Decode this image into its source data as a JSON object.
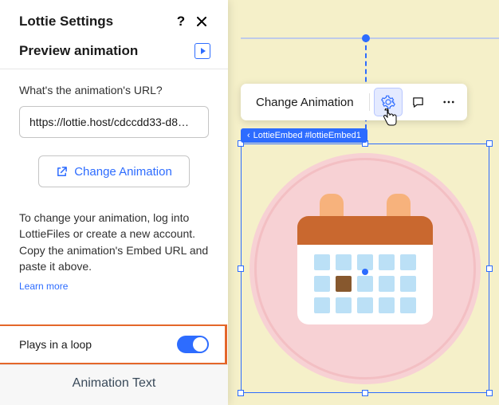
{
  "panel": {
    "title": "Lottie Settings",
    "preview_label": "Preview animation",
    "url_field_label": "What's the animation's URL?",
    "url_value": "https://lottie.host/cdccdd33-d8…",
    "change_button": "Change Animation",
    "help_text": "To change your animation, log into LottieFiles or create a new account. Copy the animation's Embed URL and paste it above.",
    "learn_more": "Learn more",
    "loop_label": "Plays in a loop",
    "loop_on": true,
    "footer_tab": "Animation Text"
  },
  "toolbar": {
    "change_label": "Change Animation"
  },
  "tag": {
    "label": "LottieEmbed #lottieEmbed1"
  }
}
